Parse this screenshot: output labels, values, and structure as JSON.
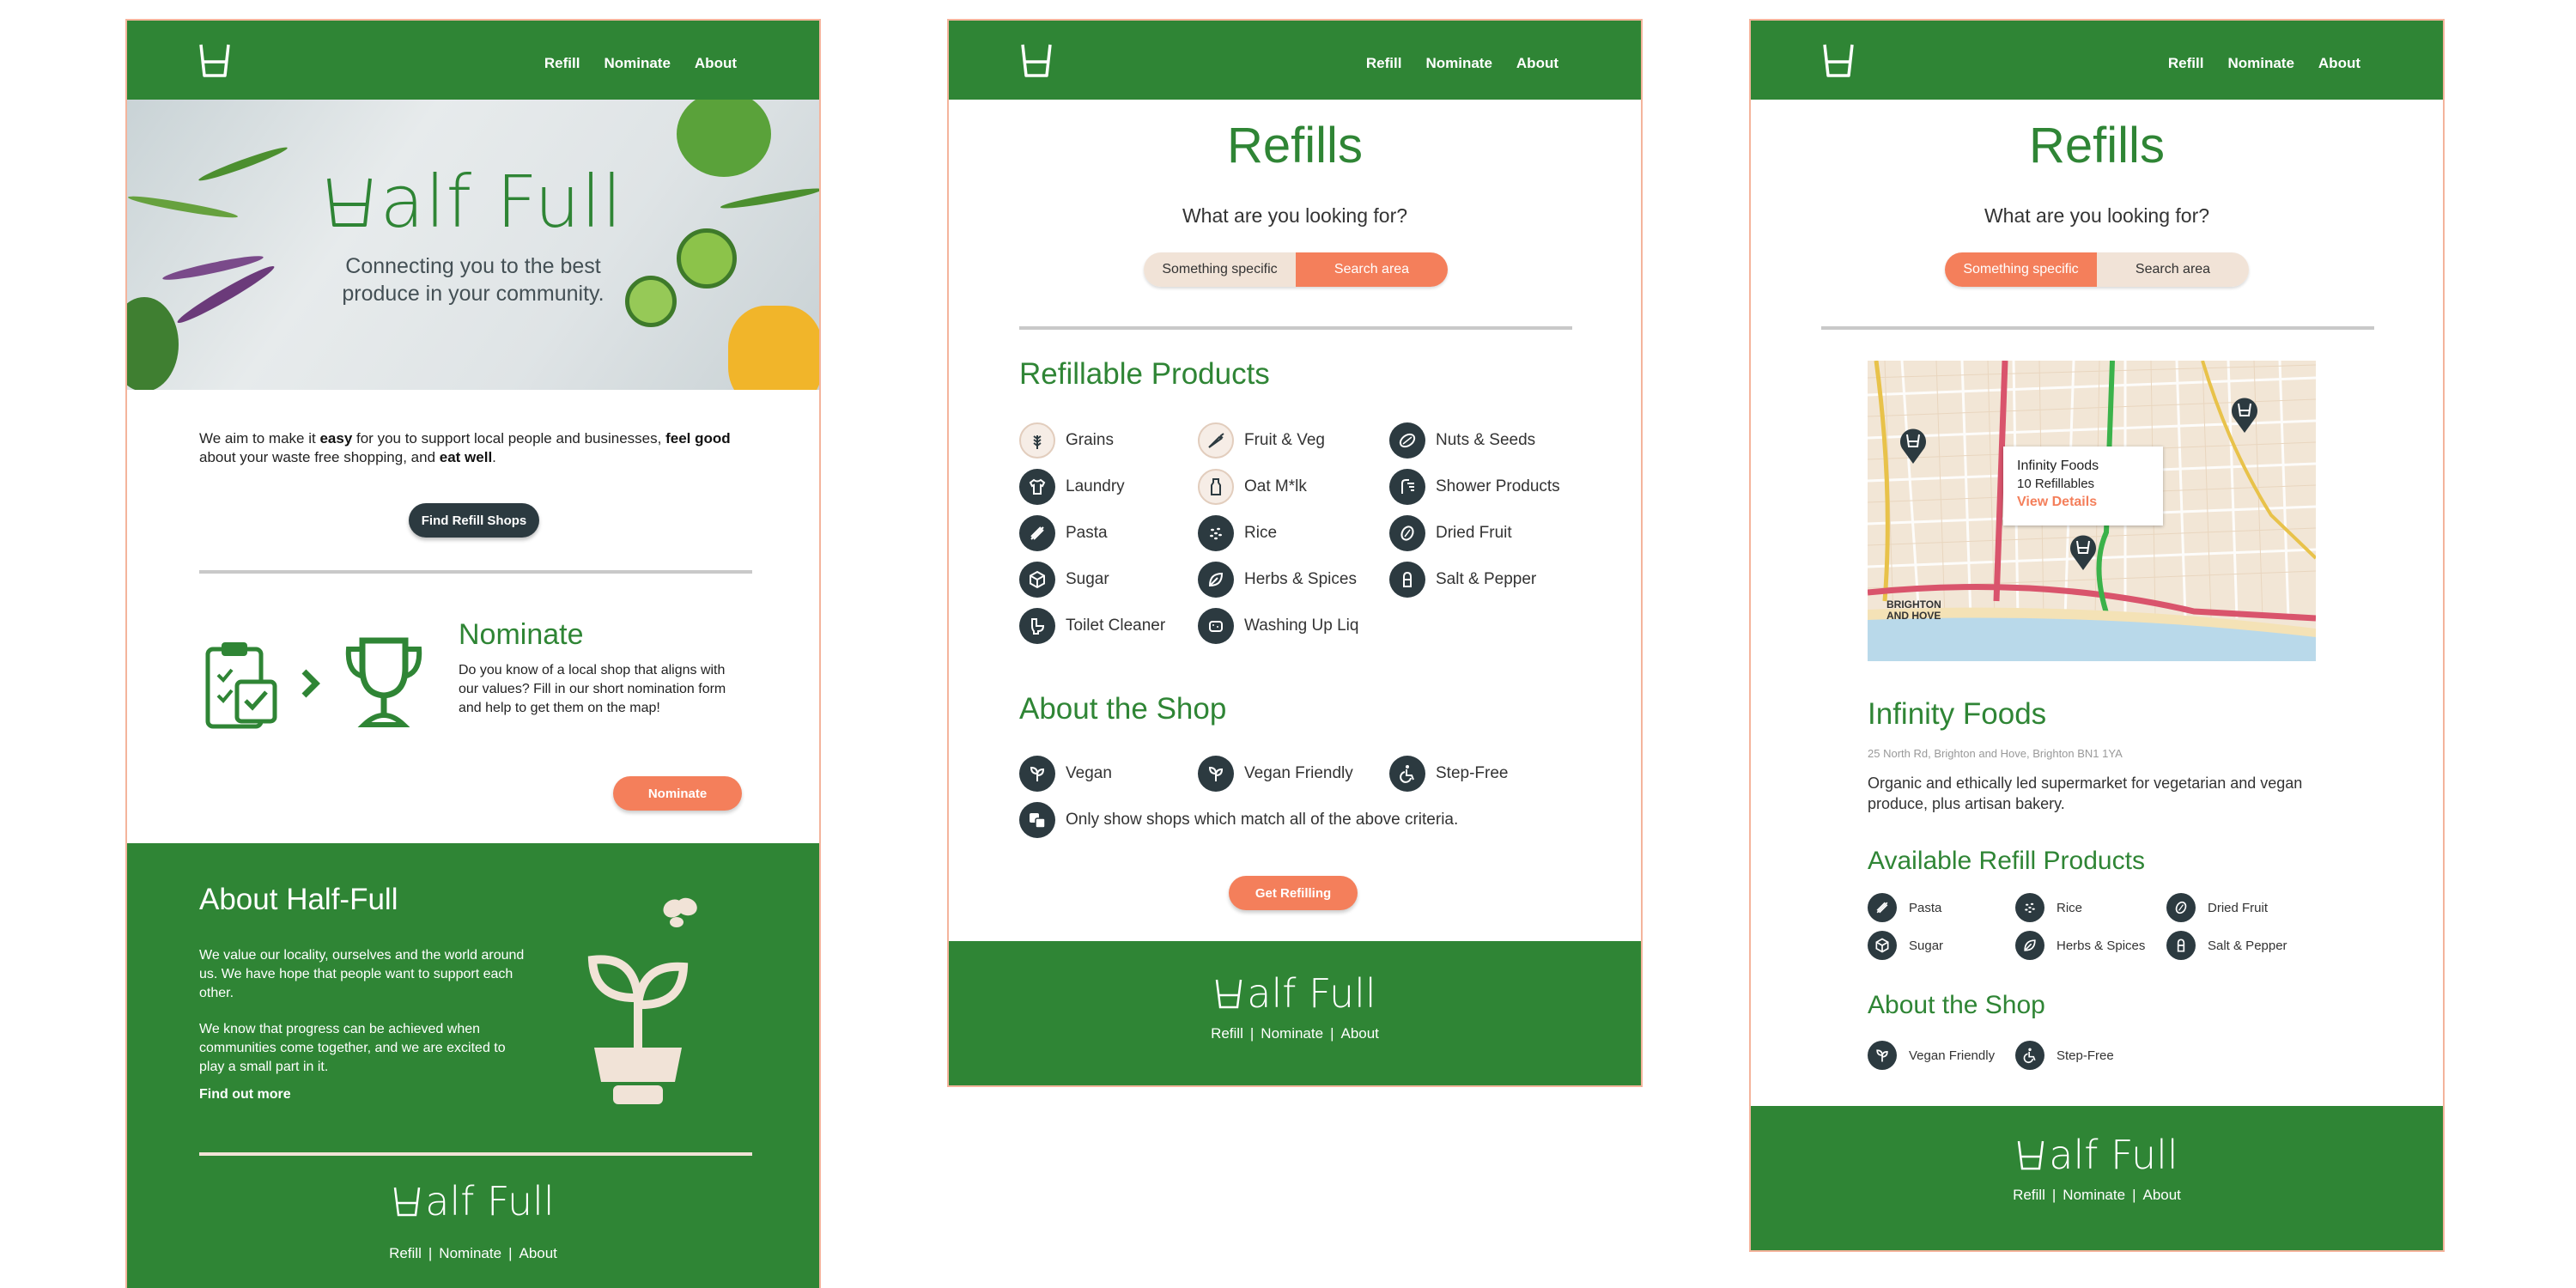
{
  "colors": {
    "brand_green": "#2f8535",
    "accent_orange": "#f47f5b",
    "dark_button": "#2c3a40",
    "cream": "#f1e3d7"
  },
  "nav": {
    "refill": "Refill",
    "nominate": "Nominate",
    "about": "About"
  },
  "home": {
    "hero_title": "alf Full",
    "hero_subtitle_line1": "Connecting you to the best",
    "hero_subtitle_line2": "produce in your community.",
    "intro_a": "We aim to make it ",
    "intro_b": "easy",
    "intro_c": " for you to support local people and businesses, ",
    "intro_d": "feel good",
    "intro_e": " about your waste free shopping, and ",
    "intro_f": "eat well",
    "intro_g": ".",
    "find_button": "Find Refill Shops",
    "nominate_title": "Nominate",
    "nominate_text": "Do you know of a local shop that aligns with our values? Fill in our short nomination form and help to get them on the map!",
    "nominate_button": "Nominate",
    "about_title": "About Half-Full",
    "about_p1": "We value our locality, ourselves and the world around us. We have hope that people want to support each other.",
    "about_p2": "We know that progress can be achieved when communities come together, and we are excited to play a small part in it.",
    "find_out_more": "Find out more"
  },
  "footer": {
    "logo_text": "alf Full",
    "link_refill": "Refill",
    "sep": "|",
    "link_nominate": "Nominate",
    "link_about": "About"
  },
  "refills": {
    "title": "Refills",
    "question": "What are you looking for?",
    "toggle_specific": "Something specific",
    "toggle_area": "Search area",
    "products_title": "Refillable Products",
    "products": [
      {
        "label": "Grains",
        "icon": "wheat-icon"
      },
      {
        "label": "Fruit & Veg",
        "icon": "carrot-icon"
      },
      {
        "label": "Nuts & Seeds",
        "icon": "nut-icon"
      },
      {
        "label": "Laundry",
        "icon": "shirt-icon"
      },
      {
        "label": "Oat M*lk",
        "icon": "bottle-icon"
      },
      {
        "label": "Shower Products",
        "icon": "shower-icon"
      },
      {
        "label": "Pasta",
        "icon": "pasta-icon"
      },
      {
        "label": "Rice",
        "icon": "rice-icon"
      },
      {
        "label": "Dried Fruit",
        "icon": "dried-fruit-icon"
      },
      {
        "label": "Sugar",
        "icon": "sugar-cube-icon"
      },
      {
        "label": "Herbs & Spices",
        "icon": "leaf-icon"
      },
      {
        "label": "Salt & Pepper",
        "icon": "salt-shaker-icon"
      },
      {
        "label": "Toilet Cleaner",
        "icon": "toilet-icon"
      },
      {
        "label": "Washing Up Liq",
        "icon": "sponge-icon"
      }
    ],
    "about_title": "About the Shop",
    "about_options": [
      {
        "label": "Vegan",
        "icon": "sprout-icon"
      },
      {
        "label": "Vegan Friendly",
        "icon": "sprout-icon"
      },
      {
        "label": "Step-Free",
        "icon": "wheelchair-icon"
      }
    ],
    "match_all": "Only show shops which match all of the above criteria.",
    "cta": "Get Refilling"
  },
  "shop": {
    "title": "Refills",
    "question": "What are you looking for?",
    "toggle_specific": "Something specific",
    "toggle_area": "Search area",
    "map_popup_name": "Infinity Foods",
    "map_popup_count": "10 Refillables",
    "map_popup_link": "View Details",
    "map_area_line1": "BRIGHTON",
    "map_area_line2": "AND HOVE",
    "name": "Infinity Foods",
    "address": "25 North Rd, Brighton and Hove, Brighton BN1 1YA",
    "description": "Organic and ethically led supermarket for vegetarian and vegan produce, plus artisan bakery.",
    "products_title": "Available Refill Products",
    "products": [
      {
        "label": "Pasta",
        "icon": "pasta-icon"
      },
      {
        "label": "Rice",
        "icon": "rice-icon"
      },
      {
        "label": "Dried Fruit",
        "icon": "dried-fruit-icon"
      },
      {
        "label": "Sugar",
        "icon": "sugar-cube-icon"
      },
      {
        "label": "Herbs & Spices",
        "icon": "leaf-icon"
      },
      {
        "label": "Salt & Pepper",
        "icon": "salt-shaker-icon"
      }
    ],
    "about_title": "About the Shop",
    "about_options": [
      {
        "label": "Vegan Friendly",
        "icon": "sprout-icon"
      },
      {
        "label": "Step-Free",
        "icon": "wheelchair-icon"
      }
    ]
  }
}
